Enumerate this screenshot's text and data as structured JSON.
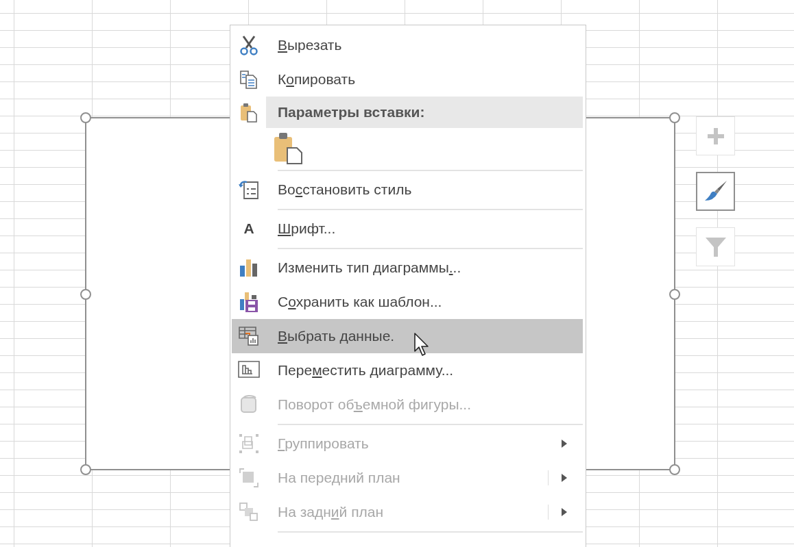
{
  "menu": {
    "items": [
      {
        "kind": "item",
        "access_key": "В",
        "label_end": "ырезать",
        "disabled": false,
        "selected": false,
        "submenu": false
      },
      {
        "kind": "item",
        "label_start": "К",
        "access_key": "о",
        "label_end": "пировать",
        "disabled": false,
        "selected": false,
        "submenu": false
      },
      {
        "kind": "header",
        "label": "Параметры вставки:"
      },
      {
        "kind": "paste-options"
      },
      {
        "kind": "separator"
      },
      {
        "kind": "item",
        "label_start": "Во",
        "access_key": "с",
        "label_end": "становить стиль",
        "disabled": false,
        "selected": false,
        "submenu": false
      },
      {
        "kind": "separator"
      },
      {
        "kind": "item",
        "icon_text": "A",
        "access_key": "Ш",
        "label_end": "рифт...",
        "disabled": false,
        "selected": false,
        "submenu": false
      },
      {
        "kind": "separator"
      },
      {
        "kind": "item",
        "label_start": "Изменить тип диаграммы",
        "access_key": ".",
        "label_end": "..",
        "disabled": false,
        "selected": false,
        "submenu": false
      },
      {
        "kind": "item",
        "label_start": "С",
        "access_key": "о",
        "label_end": "хранить как шаблон...",
        "disabled": false,
        "selected": false,
        "submenu": false
      },
      {
        "kind": "item",
        "access_key": "В",
        "label_end": "ыбрать данные.",
        "disabled": false,
        "selected": true,
        "submenu": false
      },
      {
        "kind": "item",
        "label_start": "Пере",
        "access_key": "м",
        "label_end": "естить диаграмму...",
        "disabled": false,
        "selected": false,
        "submenu": false
      },
      {
        "kind": "item",
        "label_start": "Поворот об",
        "access_key": "ъ",
        "label_end": "емной фигуры...",
        "disabled": true,
        "selected": false,
        "submenu": false
      },
      {
        "kind": "separator"
      },
      {
        "kind": "item",
        "access_key": "Г",
        "label_end": "руппировать",
        "disabled": true,
        "selected": false,
        "submenu": true,
        "split": false
      },
      {
        "kind": "item",
        "label_start": "На передний план",
        "disabled": true,
        "selected": false,
        "submenu": true,
        "split": true
      },
      {
        "kind": "item",
        "label_start": "На задн",
        "access_key": "и",
        "label_end": "й план",
        "disabled": true,
        "selected": false,
        "submenu": true,
        "split": true
      },
      {
        "kind": "separator"
      }
    ]
  },
  "chart_buttons": [
    {
      "selected": false
    },
    {
      "selected": true
    },
    {
      "selected": false
    }
  ]
}
